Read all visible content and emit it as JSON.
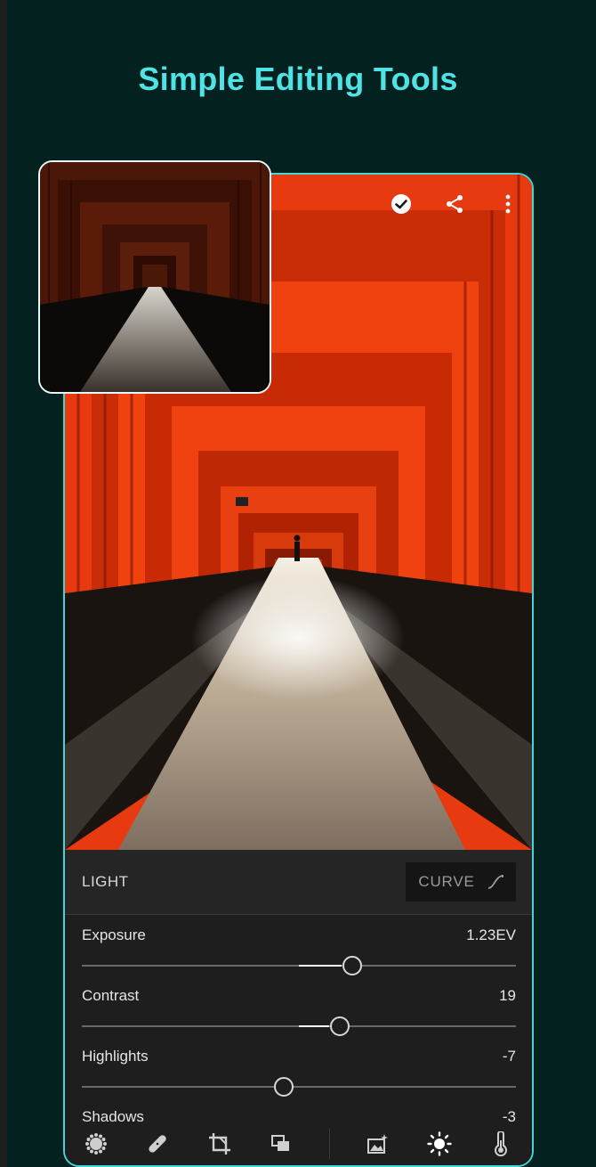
{
  "promo": {
    "title": "Simple Editing Tools"
  },
  "topbar": {
    "icons": [
      "check-circle-icon",
      "share-icon",
      "more-vertical-icon"
    ]
  },
  "panel": {
    "title": "LIGHT",
    "curve_label": "CURVE",
    "sliders": [
      {
        "label": "Exposure",
        "value": "1.23EV",
        "position": 0.623,
        "fill_from": 0.5
      },
      {
        "label": "Contrast",
        "value": "19",
        "position": 0.595,
        "fill_from": 0.5
      },
      {
        "label": "Highlights",
        "value": "-7",
        "position": 0.465,
        "fill_from": 0.5
      },
      {
        "label": "Shadows",
        "value": "-3"
      }
    ]
  },
  "toolbar": {
    "tools": [
      "presets-icon",
      "heal-icon",
      "crop-icon",
      "layers-icon",
      "auto-icon",
      "light-icon",
      "color-temperature-icon"
    ]
  },
  "colors": {
    "accent": "#4fe3e6",
    "background": "#02211f",
    "panel": "#1e1e1e"
  }
}
